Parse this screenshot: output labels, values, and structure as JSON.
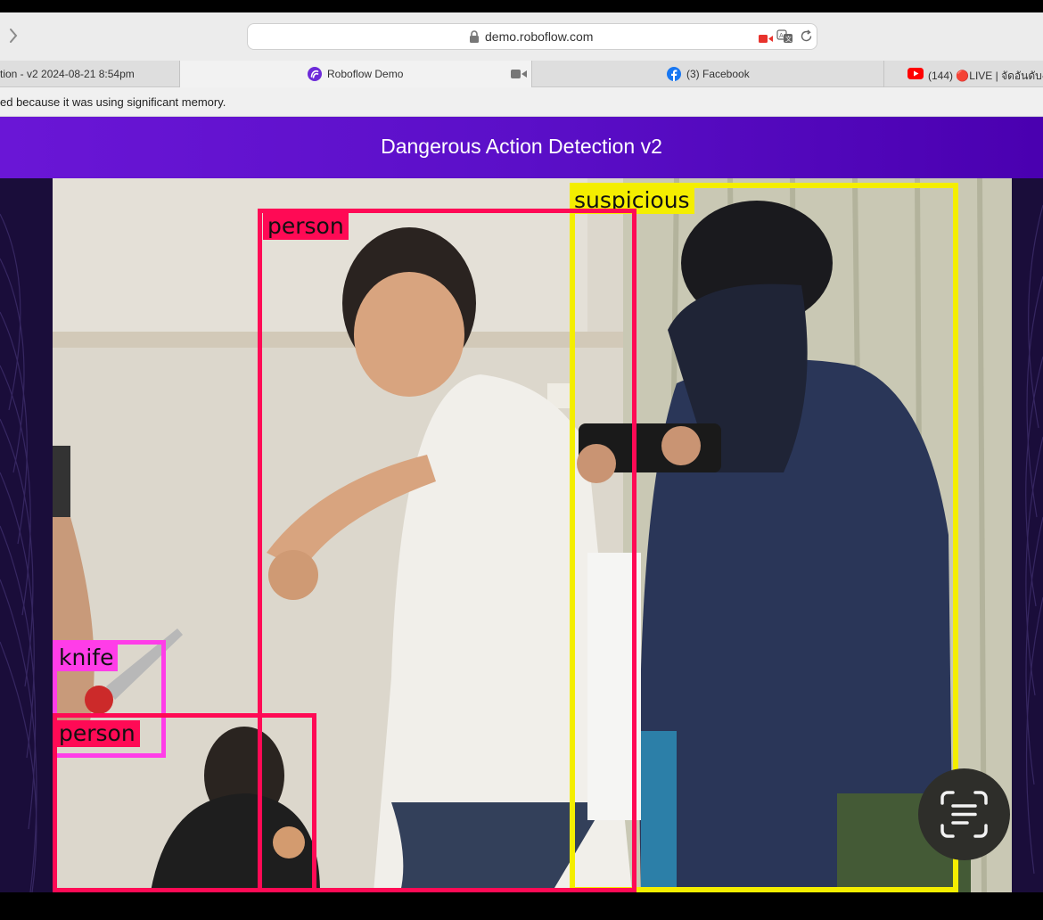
{
  "browser": {
    "url": "demo.roboflow.com",
    "tabs": [
      {
        "title": "tion - v2 2024-08-21 8:54pm"
      },
      {
        "title": "Roboflow Demo"
      },
      {
        "title": "(3) Facebook"
      },
      {
        "title": "(144) 🔴LIVE | จัดอันดับ-ไ"
      }
    ],
    "info_message": "ed because it was using significant memory."
  },
  "page": {
    "title": "Dangerous Action Detection v2"
  },
  "detections": [
    {
      "label": "suspicious",
      "color": "#f4ee00"
    },
    {
      "label": "person",
      "color": "#ff0a55"
    },
    {
      "label": "knife",
      "color": "#ff3de8"
    },
    {
      "label": "person",
      "color": "#ff0a55"
    }
  ],
  "icons": {
    "forward": "chevron-right-icon",
    "lock": "lock-icon",
    "camera": "video-camera-icon",
    "translate": "translate-icon",
    "reload": "reload-icon",
    "live_text": "live-text-icon"
  }
}
